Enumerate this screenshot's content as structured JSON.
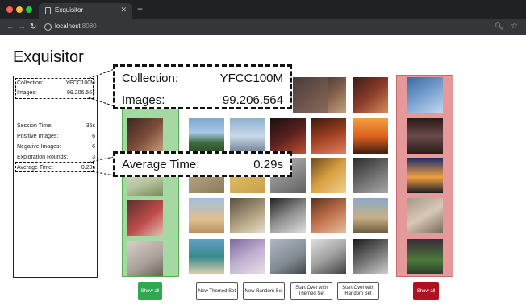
{
  "browser": {
    "tab_title": "Exquisitor",
    "url_host": "localhost",
    "url_port": ":8080"
  },
  "app": {
    "title": "Exquisitor"
  },
  "stats": {
    "collection_label": "Collection:",
    "collection_value": "YFCC100M",
    "images_label": "Images:",
    "images_value": "99.206.564",
    "session_time_label": "Session Time:",
    "session_time_value": "35s",
    "positive_label": "Positive Images:",
    "positive_value": "6",
    "negative_label": "Negative Images:",
    "negative_value": "6",
    "rounds_label": "Exploration Rounds:",
    "rounds_value": "3",
    "avg_time_label": "Average Time:",
    "avg_time_value": "0.29s"
  },
  "buttons": {
    "show_all_positive": "Show all",
    "new_themed_set": "New Themed Set",
    "new_random_set": "New Random Set",
    "start_over_themed": "Start Over with Themed Set",
    "start_over_random": "Start Over with Random Set",
    "show_all_negative": "Show all"
  },
  "colors": {
    "positive_column": "#a6d8a3",
    "negative_column": "#e6999a",
    "show_all_positive": "#2fa84f",
    "show_all_negative": "#b01020"
  },
  "icons": {
    "back": "arrow-left-icon",
    "forward": "arrow-right-icon",
    "reload": "reload-icon",
    "info": "info-icon",
    "zoom": "zoom-icon",
    "bookmark": "star-icon"
  }
}
